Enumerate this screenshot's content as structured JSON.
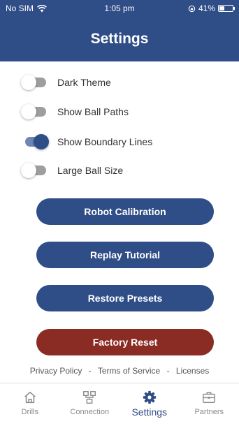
{
  "status_bar": {
    "carrier": "No SIM",
    "time": "1:05 pm",
    "battery": "41%",
    "battery_level": 0.41
  },
  "header": {
    "title": "Settings"
  },
  "toggles": [
    {
      "label": "Dark Theme",
      "on": false
    },
    {
      "label": "Show Ball Paths",
      "on": false
    },
    {
      "label": "Show Boundary Lines",
      "on": true
    },
    {
      "label": "Large Ball Size",
      "on": false
    }
  ],
  "buttons": {
    "robot_calibration": "Robot Calibration",
    "replay_tutorial": "Replay Tutorial",
    "restore_presets": "Restore Presets",
    "factory_reset": "Factory Reset"
  },
  "footer": {
    "privacy": "Privacy Policy",
    "terms": "Terms of Service",
    "licenses": "Licenses",
    "separator": "-"
  },
  "tabs": [
    {
      "label": "Drills",
      "icon": "home-icon",
      "active": false
    },
    {
      "label": "Connection",
      "icon": "network-icon",
      "active": false
    },
    {
      "label": "Settings",
      "icon": "gear-icon",
      "active": true
    },
    {
      "label": "Partners",
      "icon": "briefcase-icon",
      "active": false
    }
  ],
  "colors": {
    "primary": "#2f4d86",
    "danger": "#8b2c24",
    "toggle_off_track": "#9e9e9e",
    "toggle_on_track": "#6c86b6"
  }
}
